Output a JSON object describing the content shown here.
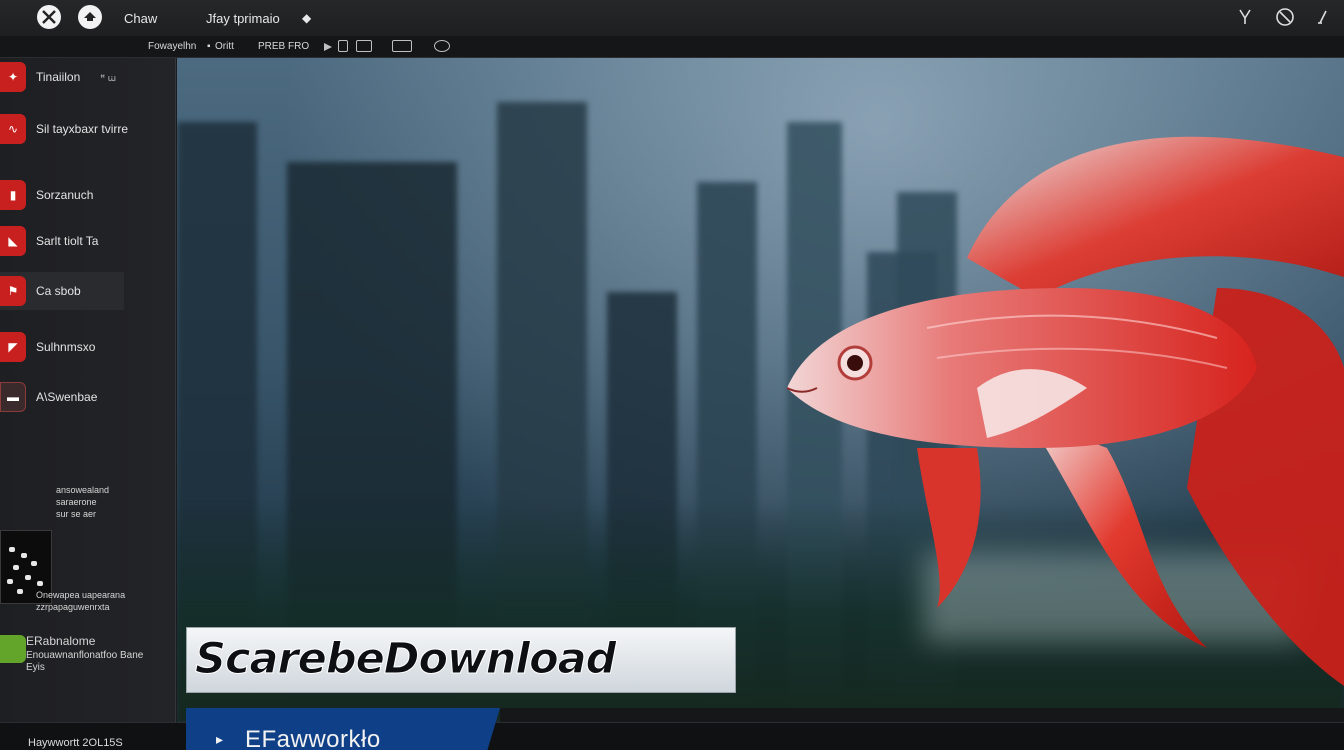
{
  "titlebar": {
    "item1_label": "Chaw",
    "item2_label": "Jfay tprimaio",
    "right_icons": [
      "cursor-icon",
      "refresh-icon",
      "pin-icon"
    ]
  },
  "toolbar": {
    "breadcrumb": "Fowayelhn",
    "separator": "▪",
    "item2": "Oritt",
    "item3": "PREB FRO"
  },
  "sidebar": {
    "items": [
      {
        "label": "Tinaiilon",
        "sub": "ꟸ ꭐ"
      },
      {
        "label": "Sil tayxbaxr tvirre"
      },
      {
        "label": "Sorzanuch"
      },
      {
        "label": "Sarlt tiolt Ta"
      },
      {
        "label": "Ca sbob"
      },
      {
        "label": "Sulhnmsxo"
      },
      {
        "label": "A\\Swenbae"
      }
    ],
    "thumb_caption": [
      "ansowealand",
      "saraerone",
      "sur se aer"
    ],
    "green_item": [
      "Onewapea uapearana",
      "zzrpapaguwenrxta"
    ],
    "footer_title": "ERabnalome",
    "footer_lines": [
      "Enouawnanflonatfoo Bane",
      "Eyis"
    ]
  },
  "banner": {
    "text": "ScarebeDownload"
  },
  "bottombar": {
    "left_text": "Haywwortt 2OL15S",
    "tab_arrow": "▸",
    "tab_text": "EFawworkło"
  },
  "colors": {
    "accent_red": "#c8201f",
    "accent_green": "#62a52a",
    "tab_blue": "#0f3f86"
  }
}
